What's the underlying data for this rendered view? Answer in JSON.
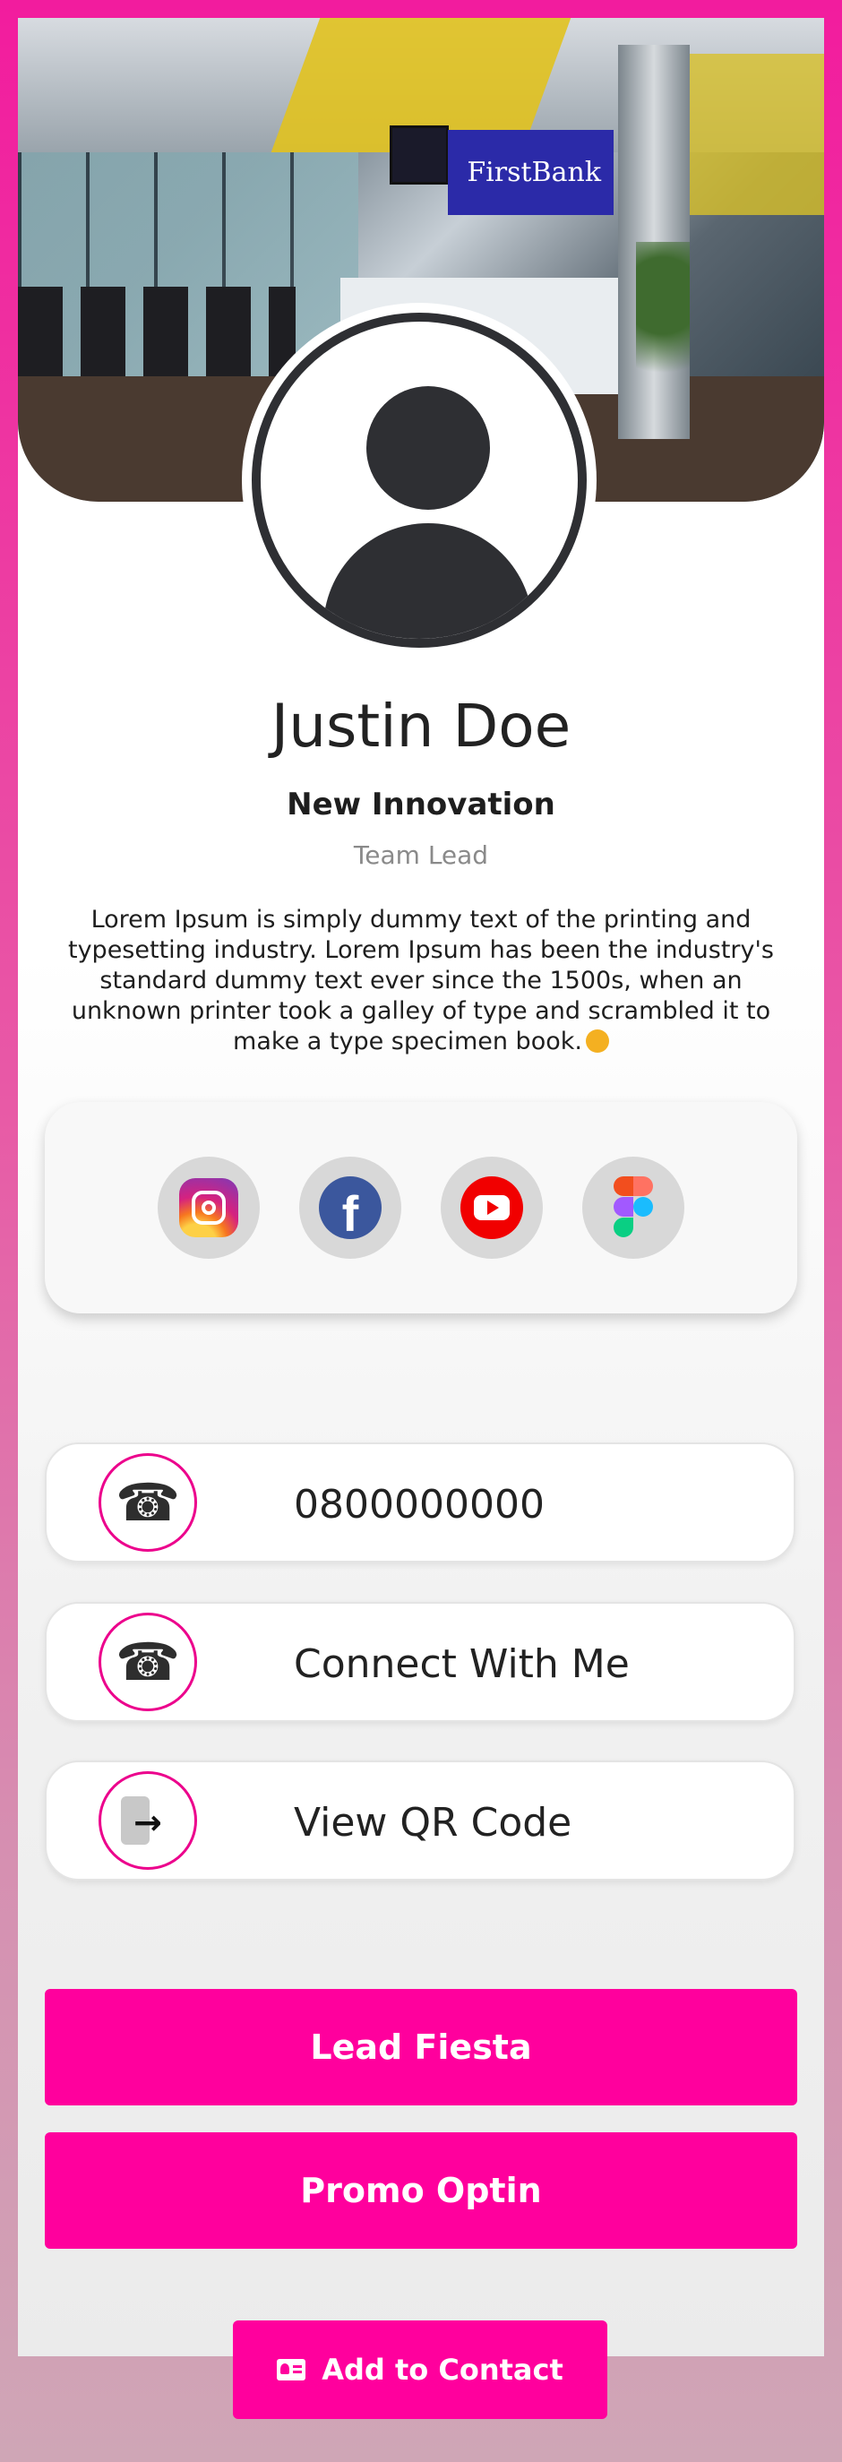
{
  "profile": {
    "cover_sign": "FirstBank",
    "name": "Justin Doe",
    "company": "New Innovation",
    "role": "Team Lead",
    "bio": "Lorem Ipsum is simply dummy text of the printing and typesetting industry. Lorem Ipsum has been the industry's standard dummy text ever since the 1500s, when an unknown printer took a galley of type and scrambled it to make a type specimen book."
  },
  "social": [
    {
      "icon": "instagram-icon"
    },
    {
      "icon": "facebook-icon"
    },
    {
      "icon": "youtube-icon"
    },
    {
      "icon": "figma-icon"
    }
  ],
  "actions": {
    "phone": {
      "label": "0800000000",
      "icon": "phone-icon"
    },
    "connect": {
      "label": "Connect With Me",
      "icon": "phone-icon"
    },
    "qr": {
      "label": "View QR Code",
      "icon": "sign-in-icon"
    }
  },
  "buttons": {
    "lead": "Lead Fiesta",
    "promo": "Promo Optin",
    "add_contact": "Add to Contact"
  },
  "colors": {
    "accent": "#ff009d",
    "ring": "#ec008c",
    "text": "#222222"
  }
}
